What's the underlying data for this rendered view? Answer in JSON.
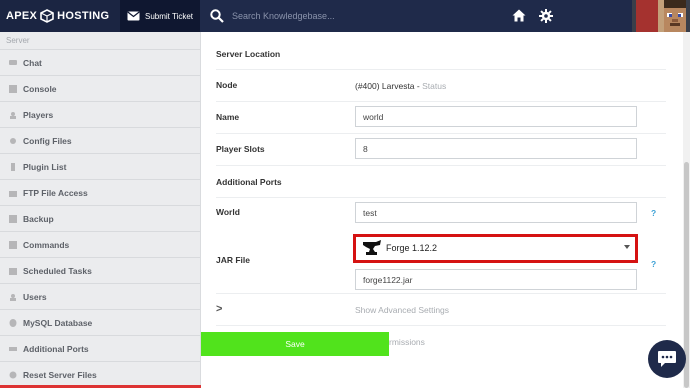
{
  "header": {
    "brand_left": "APEX",
    "brand_right": "HOSTING",
    "submit_ticket": "Submit Ticket",
    "search_placeholder": "Search Knowledgebase..."
  },
  "sidebar": {
    "section": "Server",
    "items": [
      {
        "label": "Chat"
      },
      {
        "label": "Console"
      },
      {
        "label": "Players"
      },
      {
        "label": "Config Files"
      },
      {
        "label": "Plugin List"
      },
      {
        "label": "FTP File Access"
      },
      {
        "label": "Backup"
      },
      {
        "label": "Commands"
      },
      {
        "label": "Scheduled Tasks"
      },
      {
        "label": "Users"
      },
      {
        "label": "MySQL Database"
      },
      {
        "label": "Additional Ports"
      },
      {
        "label": "Reset Server Files"
      }
    ]
  },
  "form": {
    "server_location_label": "Server Location",
    "node_label": "Node",
    "node_value": "(#400) Larvesta",
    "node_sep": " - ",
    "node_status": "Status",
    "name_label": "Name",
    "name_value": "world",
    "player_slots_label": "Player Slots",
    "player_slots_value": "8",
    "additional_ports_label": "Additional Ports",
    "world_label": "World",
    "world_value": "test",
    "jar_file_label": "JAR File",
    "jar_selected": "Forge 1.12.2",
    "jar_filename": "forge1122.jar",
    "help_mark": "?",
    "show_advanced": "Show Advanced Settings",
    "show_permissions": "Show Permissions",
    "expand_mark": ">",
    "save": "Save"
  },
  "colors": {
    "topbar": "#1f2a4a",
    "highlight": "#d51212",
    "save": "#51e31c",
    "help": "#3fa2d6"
  }
}
